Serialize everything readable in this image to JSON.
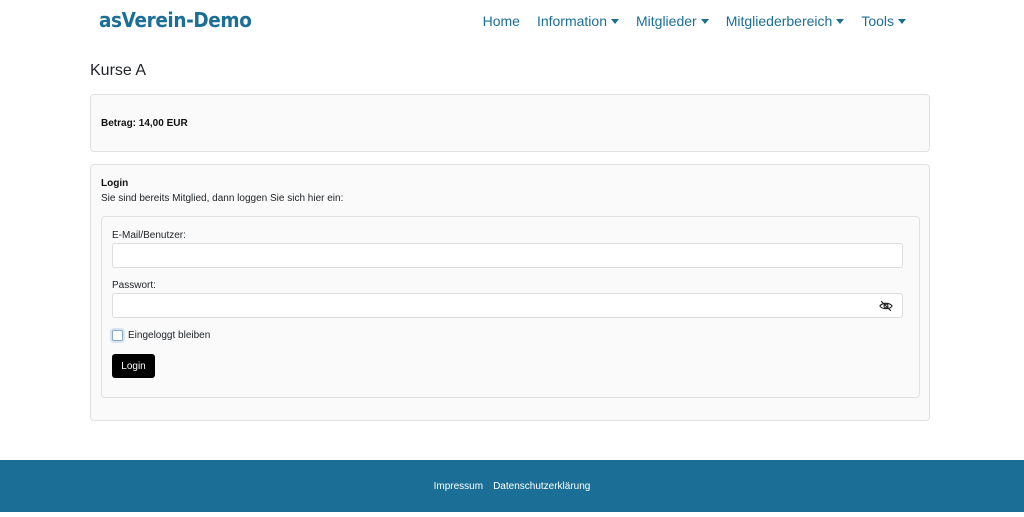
{
  "brand": {
    "name": "asVerein-Demo",
    "color": "#1b6f97"
  },
  "nav": {
    "items": [
      {
        "label": "Home",
        "dropdown": false
      },
      {
        "label": "Information",
        "dropdown": true
      },
      {
        "label": "Mitglieder",
        "dropdown": true
      },
      {
        "label": "Mitgliederbereich",
        "dropdown": true
      },
      {
        "label": "Tools",
        "dropdown": true
      }
    ]
  },
  "page": {
    "title": "Kurse A"
  },
  "amount": {
    "text": "Betrag: 14,00 EUR"
  },
  "login": {
    "title": "Login",
    "intro": "Sie sind bereits Mitglied, dann loggen Sie sich hier ein:",
    "email_label": "E-Mail/Benutzer:",
    "email_value": "",
    "password_label": "Passwort:",
    "password_value": "",
    "password_toggle_icon": "eye-slash-icon",
    "remember_label": "Eingeloggt bleiben",
    "remember_checked": false,
    "button_label": "Login"
  },
  "footer": {
    "links": [
      "Impressum",
      "Datenschutzerklärung"
    ],
    "color": "#1b6f97"
  }
}
